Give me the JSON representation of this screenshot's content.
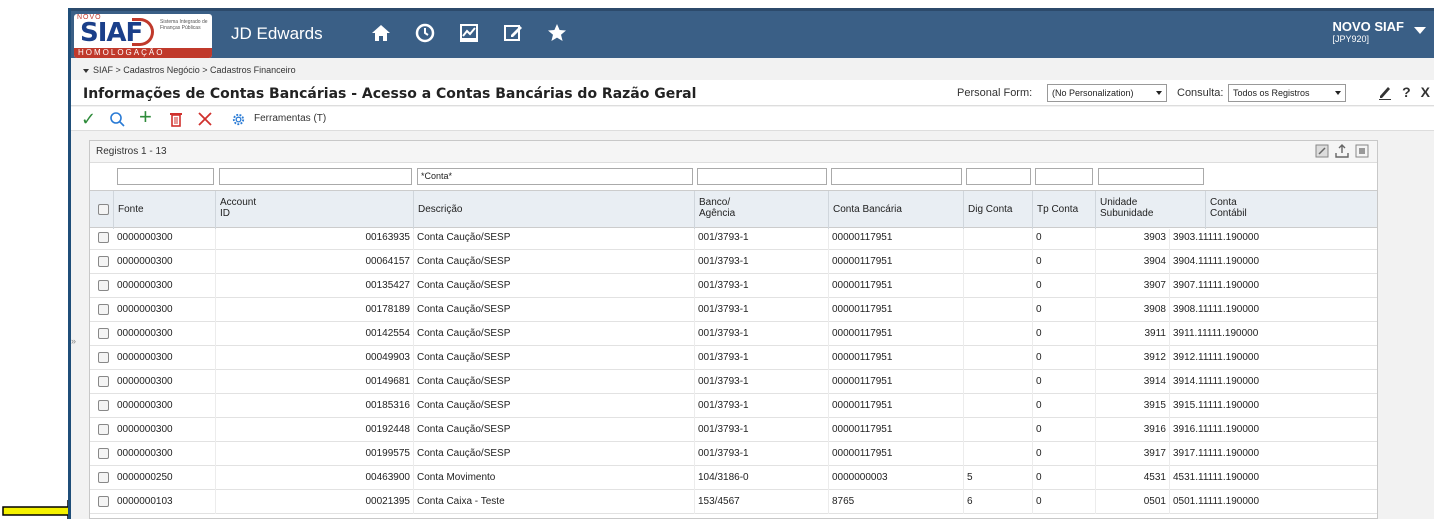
{
  "header": {
    "logo_novo": "NOVO",
    "logo_siaf": "SIAF",
    "logo_sub": "Sistema Integrado de Finanças Públicas",
    "logo_homolog": "HOMOLOGAÇÃO",
    "app_name": "JD Edwards",
    "user_name": "NOVO SIAF",
    "user_env": "[JPY920]",
    "icons": [
      "home-icon",
      "clock-icon",
      "chart-icon",
      "edit-icon",
      "star-icon"
    ]
  },
  "breadcrumb": "SIAF  >  Cadastros Negócio  >  Cadastros Financeiro",
  "form": {
    "title": "Informações de Contas Bancárias - Acesso a Contas Bancárias do Razão Geral",
    "personal_form_label": "Personal Form:",
    "personal_form_value": "(No Personalization)",
    "consulta_label": "Consulta:",
    "consulta_value": "Todos os Registros",
    "close_label": "X",
    "help_label": "?"
  },
  "toolbar": {
    "ferramentas_label": "Ferramentas (T)"
  },
  "grid": {
    "records_label": "Registros 1 - 13",
    "filter_conta": "*Conta*",
    "columns": [
      {
        "l1": "Fonte",
        "l2": ""
      },
      {
        "l1": "Account",
        "l2": "ID"
      },
      {
        "l1": "Descrição",
        "l2": ""
      },
      {
        "l1": "Banco/",
        "l2": "Agência"
      },
      {
        "l1": "Conta Bancária",
        "l2": ""
      },
      {
        "l1": "Dig Conta",
        "l2": ""
      },
      {
        "l1": "Tp Conta",
        "l2": ""
      },
      {
        "l1": "Unidade",
        "l2": "Subunidade"
      },
      {
        "l1": "Conta",
        "l2": "Contábil"
      }
    ],
    "rows": [
      {
        "fonte": "0000000300",
        "account": "00163935",
        "desc": "Conta Caução/SESP",
        "banco": "001/3793-1",
        "conta": "00000117951",
        "dig": "",
        "tp": "0",
        "unidade": "3903",
        "contabil": "3903.11111.190000"
      },
      {
        "fonte": "0000000300",
        "account": "00064157",
        "desc": "Conta Caução/SESP",
        "banco": "001/3793-1",
        "conta": "00000117951",
        "dig": "",
        "tp": "0",
        "unidade": "3904",
        "contabil": "3904.11111.190000"
      },
      {
        "fonte": "0000000300",
        "account": "00135427",
        "desc": "Conta Caução/SESP",
        "banco": "001/3793-1",
        "conta": "00000117951",
        "dig": "",
        "tp": "0",
        "unidade": "3907",
        "contabil": "3907.11111.190000"
      },
      {
        "fonte": "0000000300",
        "account": "00178189",
        "desc": "Conta Caução/SESP",
        "banco": "001/3793-1",
        "conta": "00000117951",
        "dig": "",
        "tp": "0",
        "unidade": "3908",
        "contabil": "3908.11111.190000"
      },
      {
        "fonte": "0000000300",
        "account": "00142554",
        "desc": "Conta Caução/SESP",
        "banco": "001/3793-1",
        "conta": "00000117951",
        "dig": "",
        "tp": "0",
        "unidade": "3911",
        "contabil": "3911.11111.190000"
      },
      {
        "fonte": "0000000300",
        "account": "00049903",
        "desc": "Conta Caução/SESP",
        "banco": "001/3793-1",
        "conta": "00000117951",
        "dig": "",
        "tp": "0",
        "unidade": "3912",
        "contabil": "3912.11111.190000"
      },
      {
        "fonte": "0000000300",
        "account": "00149681",
        "desc": "Conta Caução/SESP",
        "banco": "001/3793-1",
        "conta": "00000117951",
        "dig": "",
        "tp": "0",
        "unidade": "3914",
        "contabil": "3914.11111.190000"
      },
      {
        "fonte": "0000000300",
        "account": "00185316",
        "desc": "Conta Caução/SESP",
        "banco": "001/3793-1",
        "conta": "00000117951",
        "dig": "",
        "tp": "0",
        "unidade": "3915",
        "contabil": "3915.11111.190000"
      },
      {
        "fonte": "0000000300",
        "account": "00192448",
        "desc": "Conta Caução/SESP",
        "banco": "001/3793-1",
        "conta": "00000117951",
        "dig": "",
        "tp": "0",
        "unidade": "3916",
        "contabil": "3916.11111.190000"
      },
      {
        "fonte": "0000000300",
        "account": "00199575",
        "desc": "Conta Caução/SESP",
        "banco": "001/3793-1",
        "conta": "00000117951",
        "dig": "",
        "tp": "0",
        "unidade": "3917",
        "contabil": "3917.11111.190000"
      },
      {
        "fonte": "0000000250",
        "account": "00463900",
        "desc": "Conta Movimento",
        "banco": "104/3186-0",
        "conta": "0000000003",
        "dig": "5",
        "tp": "0",
        "unidade": "4531",
        "contabil": "4531.11111.190000"
      },
      {
        "fonte": "0000000103",
        "account": "00021395",
        "desc": "Conta Caixa - Teste",
        "banco": "153/4567",
        "conta": "8765",
        "dig": "6",
        "tp": "0",
        "unidade": "0501",
        "contabil": "0501.11111.190000"
      }
    ]
  },
  "colors": {
    "header_bg": "#3a5f86",
    "accent_green": "#2e8b3a",
    "accent_red": "#d0312d",
    "accent_blue": "#2a7bd5",
    "annotation_arrow": "#f5f200"
  }
}
